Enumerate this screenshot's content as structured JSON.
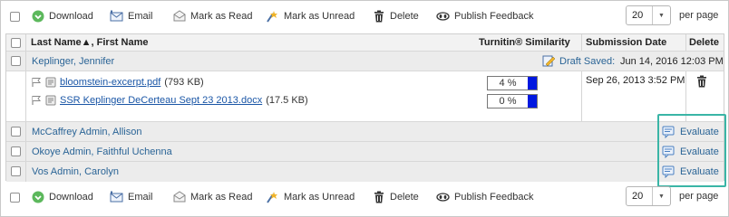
{
  "toolbar": {
    "download": "Download",
    "email": "Email",
    "mark_read": "Mark as Read",
    "mark_unread": "Mark as Unread",
    "delete": "Delete",
    "publish": "Publish Feedback",
    "per_page_value": "20",
    "per_page_label": "per page"
  },
  "table": {
    "headers": {
      "name": "Last Name▲, First Name",
      "turnitin": "Turnitin® Similarity",
      "date": "Submission Date",
      "delete": "Delete"
    },
    "group": {
      "name": "Keplinger, Jennifer",
      "draft_label": "Draft Saved:",
      "draft_date": "Jun 14, 2016 12:03 PM"
    },
    "files": [
      {
        "name": "bloomstein-excerpt.pdf",
        "size": "(793 KB)",
        "similarity": "4 %"
      },
      {
        "name": "SSR Keplinger DeCerteau Sept 23 2013.docx",
        "size": "(17.5 KB)",
        "similarity": "0 %"
      }
    ],
    "submission_date": "Sep 26, 2013 3:52 PM",
    "students": [
      {
        "name": "McCaffrey Admin, Allison",
        "action": "Evaluate"
      },
      {
        "name": "Okoye Admin, Faithful Uchenna",
        "action": "Evaluate"
      },
      {
        "name": "Vos Admin, Carolyn",
        "action": "Evaluate"
      }
    ]
  },
  "colors": {
    "link": "#2a6496",
    "highlight": "#3ab5a6",
    "similarity_bar": "#0018e0",
    "download_icon": "#4caf50"
  },
  "icons": [
    "checkbox",
    "download-icon",
    "email-icon",
    "mark-read-icon",
    "mark-unread-icon",
    "trash-icon",
    "publish-icon",
    "flag-icon",
    "file-icon",
    "draft-icon",
    "evaluate-icon"
  ]
}
